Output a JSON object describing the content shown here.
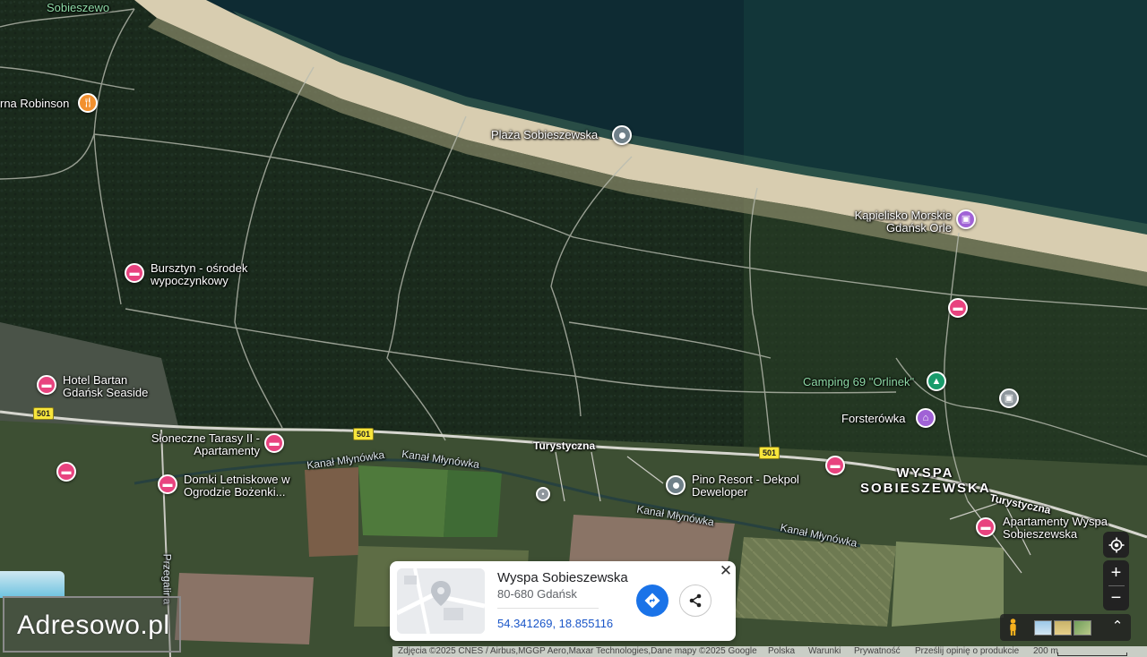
{
  "map": {
    "labels": {
      "sobieszewo": "Sobieszewo",
      "robinson": "rna Robinson",
      "plaza": "Plaża Sobieszewska",
      "kapielisko": "Kąpielisko Morskie Gdańsk Orle",
      "bursztyn": "Bursztyn - ośrodek wypoczynkowy",
      "hotel_bartan": "Hotel Bartan Gdańsk Seaside",
      "sloneczne": "Słoneczne Tarasy II - Apartamenty",
      "domki": "Domki Letniskowe w Ogrodzie Bożenki...",
      "pino": "Pino Resort - Dekpol Deweloper",
      "camping": "Camping 69 \"Orlinek\"",
      "forsterowka": "Forsterówka",
      "wyspa_area": "WYSPA SOBIESZEWSKA",
      "apartamenty": "Apartamenty Wyspa Sobieszewska",
      "turystyczna_1": "Turystyczna",
      "turystyczna_2": "Turystyczna",
      "kanal_1": "Kanał Młynówka",
      "kanal_2": "Kanał Młynówka",
      "kanal_3": "Kanał Młynówka",
      "kanal_4": "Kanał Młynówka",
      "przegalina": "Przegalina",
      "route_1": "501",
      "route_2": "501",
      "route_3": "501"
    },
    "icons": {
      "hotel": "bed-icon",
      "restaurant": "fork-knife-icon",
      "attraction": "camera-icon",
      "campground": "tent-icon",
      "museum": "museum-icon",
      "place": "map-pin-icon"
    }
  },
  "place_card": {
    "title": "Wyspa Sobieszewska",
    "address": "80-680 Gdańsk",
    "coordinates": "54.341269, 18.855116",
    "directions_icon": "directions-icon",
    "share_icon": "share-icon",
    "close_symbol": "✕"
  },
  "controls": {
    "zoom_in": "+",
    "zoom_out": "−",
    "locate_icon": "my-location-icon",
    "layers_expand": "⌃"
  },
  "attribution": {
    "imagery": "Zdjęcia ©2025 CNES / Airbus,MGGP Aero,Maxar Technologies,Dane mapy ©2025 Google",
    "country": "Polska",
    "terms": "Warunki",
    "privacy": "Prywatność",
    "feedback": "Prześlij opinię o produkcie",
    "scale": "200 m"
  },
  "watermark": {
    "text": "Adresowo.pl"
  },
  "colors": {
    "hotel_pin": "#e8437f",
    "attraction_pin": "#a062d6",
    "food_pin": "#f2902f",
    "camping_pin": "#199b6b",
    "link": "#1a56c8",
    "directions": "#1a73e8"
  }
}
